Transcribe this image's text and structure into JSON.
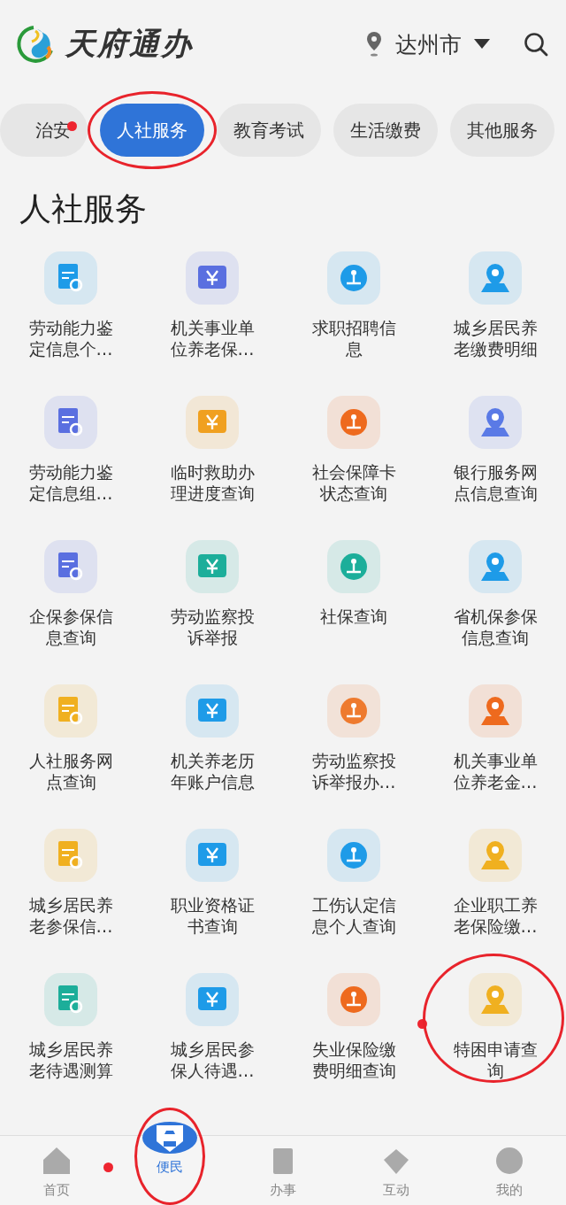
{
  "header": {
    "logo_text": "天府通办",
    "city": "达州市"
  },
  "tabs": [
    {
      "label": "治安",
      "selected": false,
      "circled": false,
      "dot": true
    },
    {
      "label": "人社服务",
      "selected": true,
      "circled": true,
      "dot": false
    },
    {
      "label": "教育考试",
      "selected": false,
      "circled": false,
      "dot": false
    },
    {
      "label": "生活缴费",
      "selected": false,
      "circled": false,
      "dot": false
    },
    {
      "label": "其他服务",
      "selected": false,
      "circled": false,
      "dot": false
    }
  ],
  "section_title": "人社服务",
  "services": [
    {
      "label": "劳动能力鉴定信息个…",
      "color": "#1e9be8",
      "circled": false,
      "dot": false
    },
    {
      "label": "机关事业单位养老保…",
      "color": "#5a6fe0",
      "circled": false,
      "dot": false
    },
    {
      "label": "求职招聘信息",
      "color": "#1e9be8",
      "circled": false,
      "dot": false
    },
    {
      "label": "城乡居民养老缴费明细",
      "color": "#1e9be8",
      "circled": false,
      "dot": false
    },
    {
      "label": "劳动能力鉴定信息组…",
      "color": "#5a6fe0",
      "circled": false,
      "dot": false
    },
    {
      "label": "临时救助办理进度查询",
      "color": "#f0a020",
      "circled": false,
      "dot": false
    },
    {
      "label": "社会保障卡状态查询",
      "color": "#ee6a1e",
      "circled": false,
      "dot": false
    },
    {
      "label": "银行服务网点信息查询",
      "color": "#5a7ae6",
      "circled": false,
      "dot": false
    },
    {
      "label": "企保参保信息查询",
      "color": "#5a6fe0",
      "circled": false,
      "dot": false
    },
    {
      "label": "劳动监察投诉举报",
      "color": "#1cae9a",
      "circled": false,
      "dot": false
    },
    {
      "label": "社保查询",
      "color": "#1cae9a",
      "circled": false,
      "dot": false
    },
    {
      "label": "省机保参保信息查询",
      "color": "#1e9be8",
      "circled": false,
      "dot": false
    },
    {
      "label": "人社服务网点查询",
      "color": "#f0b020",
      "circled": false,
      "dot": false
    },
    {
      "label": "机关养老历年账户信息",
      "color": "#1e9be8",
      "circled": false,
      "dot": false
    },
    {
      "label": "劳动监察投诉举报办…",
      "color": "#ee7a2e",
      "circled": false,
      "dot": false
    },
    {
      "label": "机关事业单位养老金…",
      "color": "#ee6a1e",
      "circled": false,
      "dot": false
    },
    {
      "label": "城乡居民养老参保信…",
      "color": "#f0b020",
      "circled": false,
      "dot": false
    },
    {
      "label": "职业资格证书查询",
      "color": "#1e9be8",
      "circled": false,
      "dot": false
    },
    {
      "label": "工伤认定信息个人查询",
      "color": "#1e9be8",
      "circled": false,
      "dot": false
    },
    {
      "label": "企业职工养老保险缴…",
      "color": "#f0b020",
      "circled": false,
      "dot": false
    },
    {
      "label": "城乡居民养老待遇测算",
      "color": "#1cae9a",
      "circled": false,
      "dot": false
    },
    {
      "label": "城乡居民参保人待遇…",
      "color": "#1e9be8",
      "circled": false,
      "dot": false
    },
    {
      "label": "失业保险缴费明细查询",
      "color": "#ee6a1e",
      "circled": false,
      "dot": true
    },
    {
      "label": "特困申请查询",
      "color": "#f0b020",
      "circled": true,
      "dot": false
    }
  ],
  "nav": [
    {
      "label": "首页",
      "selected": false,
      "circled": false,
      "dot": true
    },
    {
      "label": "便民",
      "selected": true,
      "circled": true,
      "dot": false
    },
    {
      "label": "办事",
      "selected": false,
      "circled": false,
      "dot": false
    },
    {
      "label": "互动",
      "selected": false,
      "circled": false,
      "dot": false
    },
    {
      "label": "我的",
      "selected": false,
      "circled": false,
      "dot": false
    }
  ]
}
